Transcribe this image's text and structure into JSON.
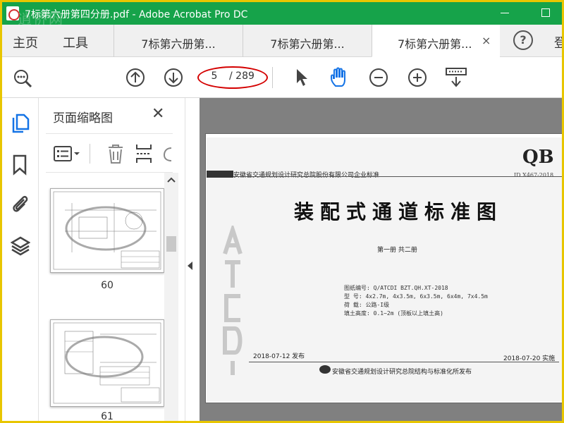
{
  "window": {
    "title": "7标第六册第四分册.pdf - Adobe Acrobat Pro DC",
    "watermark": "逍侨网"
  },
  "tabbar": {
    "home": "主页",
    "tools": "工具",
    "tabs": [
      {
        "label": "7标第六册第..."
      },
      {
        "label": "7标第六册第..."
      },
      {
        "label": "7标第六册第..."
      }
    ],
    "close": "×",
    "help": "?",
    "signin": "登"
  },
  "toolbar": {
    "page_current": "5",
    "page_total": "/ 289"
  },
  "thumbnails": {
    "title": "页面缩略图",
    "close": "✕",
    "pages": [
      {
        "label": "60"
      },
      {
        "label": "61"
      }
    ]
  },
  "document": {
    "qb": "QB",
    "std_no": "ID X467-2018",
    "org": "安徽省交通规划设计研究总院股份有限公司企业标准",
    "title": "装配式通道标准图",
    "volume": "第一册  共二册",
    "meta": [
      "图纸编号:  Q/ATCDI BZT.QH.XT-2018",
      "型    号:  4x2.7m, 4x3.5m, 6x3.5m, 6x4m, 7x4.5m",
      "荷    载:  公路-I级",
      "填土高度:  0.1~2m (顶板以上填土高)"
    ],
    "date_issue": "2018-07-12 发布",
    "date_effective": "2018-07-20 实施",
    "publisher": "安徽省交通规划设计研究总院结构与标准化所发布"
  },
  "colors": {
    "titlebar": "#16a34a",
    "frame": "#e8c600",
    "accent": "#1473e6",
    "annotation": "#d40000"
  }
}
